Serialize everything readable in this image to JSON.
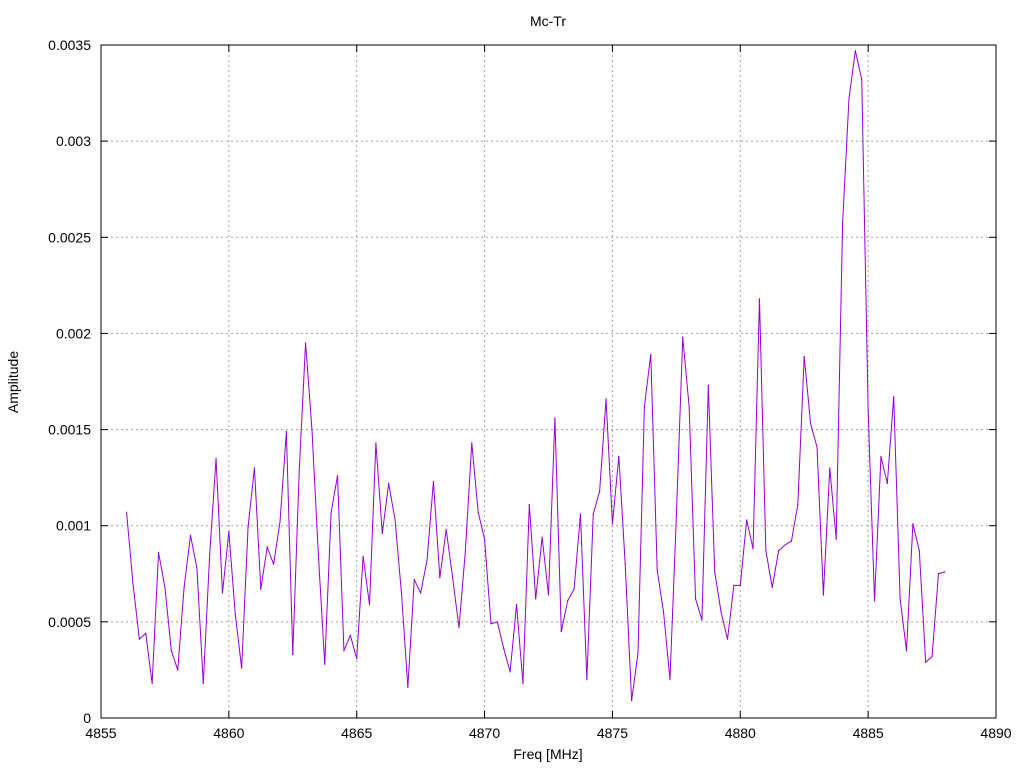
{
  "chart_data": {
    "type": "line",
    "title": "Mc-Tr",
    "xlabel": "Freq [MHz]",
    "ylabel": "Amplitude",
    "xlim": [
      4855,
      4890
    ],
    "ylim": [
      0,
      0.0035
    ],
    "grid": true,
    "x_ticks": [
      4855,
      4860,
      4865,
      4870,
      4875,
      4880,
      4885,
      4890
    ],
    "x_tick_labels": [
      "4855",
      "4860",
      "4865",
      "4870",
      "4875",
      "4880",
      "4885",
      "4890"
    ],
    "y_ticks": [
      0,
      0.0005,
      0.001,
      0.0015,
      0.002,
      0.0025,
      0.003,
      0.0035
    ],
    "y_tick_labels": [
      "0",
      "0.0005",
      "0.001",
      "0.0015",
      "0.002",
      "0.0025",
      "0.003",
      "0.0035"
    ],
    "series": [
      {
        "color": "#9400d3",
        "x": [
          4856.0,
          4856.25,
          4856.5,
          4856.75,
          4857.0,
          4857.25,
          4857.5,
          4857.75,
          4858.0,
          4858.25,
          4858.5,
          4858.75,
          4859.0,
          4859.25,
          4859.5,
          4859.75,
          4860.0,
          4860.25,
          4860.5,
          4860.75,
          4861.0,
          4861.25,
          4861.5,
          4861.75,
          4862.0,
          4862.25,
          4862.5,
          4862.75,
          4863.0,
          4863.25,
          4863.5,
          4863.75,
          4864.0,
          4864.25,
          4864.5,
          4864.75,
          4865.0,
          4865.25,
          4865.5,
          4865.75,
          4866.0,
          4866.25,
          4866.5,
          4866.75,
          4867.0,
          4867.25,
          4867.5,
          4867.75,
          4868.0,
          4868.25,
          4868.5,
          4868.75,
          4869.0,
          4869.25,
          4869.5,
          4869.75,
          4870.0,
          4870.25,
          4870.5,
          4870.75,
          4871.0,
          4871.25,
          4871.5,
          4871.75,
          4872.0,
          4872.25,
          4872.5,
          4872.75,
          4873.0,
          4873.25,
          4873.5,
          4873.75,
          4874.0,
          4874.25,
          4874.5,
          4874.75,
          4875.0,
          4875.25,
          4875.5,
          4875.75,
          4876.0,
          4876.25,
          4876.5,
          4876.75,
          4877.0,
          4877.25,
          4877.5,
          4877.75,
          4878.0,
          4878.25,
          4878.5,
          4878.75,
          4879.0,
          4879.25,
          4879.5,
          4879.75,
          4880.0,
          4880.25,
          4880.5,
          4880.75,
          4881.0,
          4881.25,
          4881.5,
          4881.75,
          4882.0,
          4882.25,
          4882.5,
          4882.75,
          4883.0,
          4883.25,
          4883.5,
          4883.75,
          4884.0,
          4884.25,
          4884.5,
          4884.75,
          4885.0,
          4885.25,
          4885.5,
          4885.75,
          4886.0,
          4886.25,
          4886.5,
          4886.75,
          4887.0,
          4887.25,
          4887.5,
          4887.75,
          4888.0
        ],
        "y": [
          0.00107,
          0.0007,
          0.00041,
          0.00044,
          0.00018,
          0.00086,
          0.00068,
          0.00035,
          0.00025,
          0.00068,
          0.00095,
          0.00078,
          0.00018,
          0.00085,
          0.00135,
          0.00065,
          0.00097,
          0.00054,
          0.00026,
          0.00099,
          0.0013,
          0.00067,
          0.00089,
          0.0008,
          0.00102,
          0.00149,
          0.00033,
          0.00128,
          0.00195,
          0.0015,
          0.00085,
          0.00028,
          0.00107,
          0.00126,
          0.00035,
          0.00043,
          0.00031,
          0.00084,
          0.00059,
          0.00143,
          0.00096,
          0.00122,
          0.00103,
          0.00065,
          0.00016,
          0.00072,
          0.00065,
          0.00082,
          0.00123,
          0.00073,
          0.00098,
          0.00073,
          0.00047,
          0.00087,
          0.00143,
          0.00107,
          0.00093,
          0.00049,
          0.0005,
          0.00036,
          0.00024,
          0.00059,
          0.00018,
          0.00111,
          0.00062,
          0.00094,
          0.00064,
          0.00156,
          0.00045,
          0.00061,
          0.00067,
          0.00106,
          0.0002,
          0.00106,
          0.00118,
          0.00166,
          0.00101,
          0.00136,
          0.0008,
          9e-05,
          0.00034,
          0.00162,
          0.00189,
          0.00077,
          0.00055,
          0.0002,
          0.00105,
          0.00198,
          0.00162,
          0.00062,
          0.00051,
          0.00173,
          0.00076,
          0.00055,
          0.00041,
          0.00069,
          0.00069,
          0.00103,
          0.00088,
          0.00218,
          0.00087,
          0.00068,
          0.00087,
          0.0009,
          0.00092,
          0.00111,
          0.00188,
          0.00153,
          0.00141,
          0.00064,
          0.0013,
          0.00093,
          0.00257,
          0.00322,
          0.00347,
          0.00332,
          0.0016,
          0.00061,
          0.00136,
          0.00122,
          0.00167,
          0.00062,
          0.00035,
          0.00101,
          0.00087,
          0.00029,
          0.00032,
          0.00075,
          0.00076
        ]
      }
    ]
  }
}
